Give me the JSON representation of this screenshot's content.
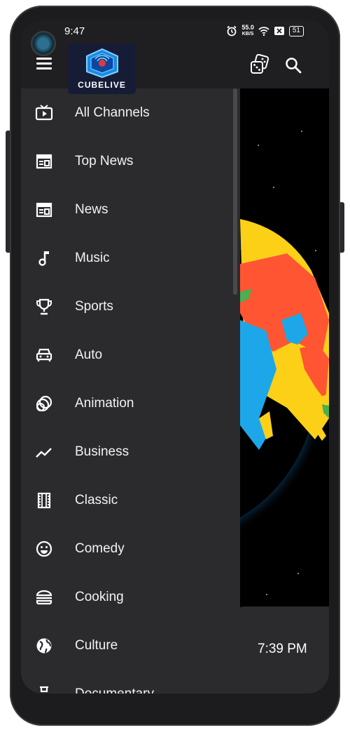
{
  "status_bar": {
    "time": "9:47",
    "net_speed_value": "55.0",
    "net_speed_unit": "KB/S",
    "battery": "51"
  },
  "app": {
    "logo_text": "CUBELIVE"
  },
  "drawer": {
    "items": [
      {
        "label": "All Channels",
        "icon": "tv-icon"
      },
      {
        "label": "Top News",
        "icon": "newspaper-icon"
      },
      {
        "label": "News",
        "icon": "newspaper-icon"
      },
      {
        "label": "Music",
        "icon": "music-note-icon"
      },
      {
        "label": "Sports",
        "icon": "trophy-icon"
      },
      {
        "label": "Auto",
        "icon": "car-icon"
      },
      {
        "label": "Animation",
        "icon": "animation-icon"
      },
      {
        "label": "Business",
        "icon": "trending-icon"
      },
      {
        "label": "Classic",
        "icon": "film-icon"
      },
      {
        "label": "Comedy",
        "icon": "smiley-icon"
      },
      {
        "label": "Cooking",
        "icon": "burger-icon"
      },
      {
        "label": "Culture",
        "icon": "globe-icon"
      },
      {
        "label": "Documentary",
        "icon": "documentary-icon"
      }
    ]
  },
  "content": {
    "card_time": "7:39 PM"
  },
  "colors": {
    "drawer_bg": "#2b2b2d",
    "app_bar_bg": "#1f1f21",
    "text": "#f2f2f2"
  }
}
